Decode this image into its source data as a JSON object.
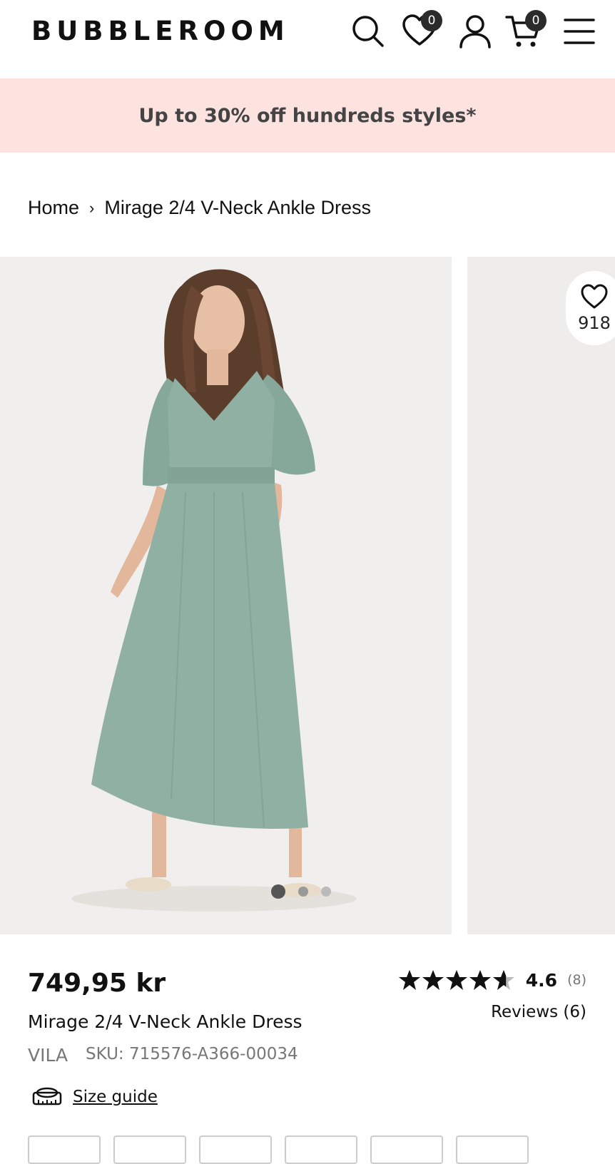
{
  "header": {
    "logo": "BUBBLEROOM",
    "wishlist_count": "0",
    "cart_count": "0"
  },
  "promo": {
    "text": "Up to 30% off hundreds styles*"
  },
  "breadcrumb": {
    "home": "Home",
    "separator": "›",
    "current": "Mirage 2/4 V-Neck Ankle Dress"
  },
  "gallery": {
    "favorite_count": "918",
    "dots": 3,
    "active_dot": 0
  },
  "product": {
    "price": "749,95 kr",
    "name": "Mirage 2/4 V-Neck Ankle Dress",
    "brand": "VILA",
    "sku": "SKU: 715576-A366-00034",
    "rating_value": "4.6",
    "rating_count": "(8)",
    "rating_stars": 4.6,
    "reviews_link": "Reviews (6)",
    "size_guide": "Size guide"
  },
  "colors": {
    "promo_bg": "#fde3df",
    "dress": "#8fb0a3",
    "text": "#111111",
    "muted": "#777777"
  }
}
